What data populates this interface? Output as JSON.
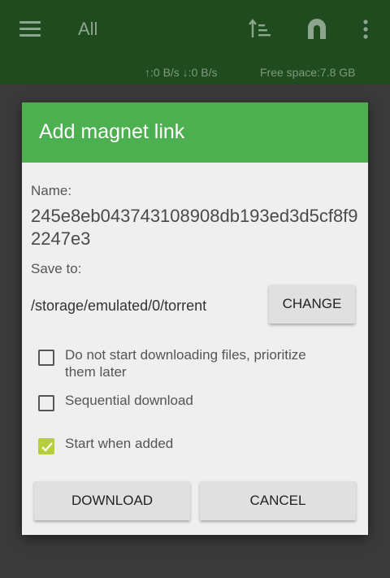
{
  "appbar": {
    "title": "All",
    "icons": [
      "menu-icon",
      "sort-icon",
      "magnet-icon",
      "more-vert-icon"
    ]
  },
  "status": {
    "speed": "↑:0 B/s  ↓:0 B/s",
    "free_space": "Free space:7.8 GB"
  },
  "dialog": {
    "title": "Add magnet link",
    "name_label": "Name:",
    "name_value": "245e8eb043743108908db193ed3d5cf8f92247e3",
    "save_label": "Save to:",
    "save_path": "/storage/emulated/0/torrent",
    "change_label": "CHANGE",
    "options": [
      {
        "label": "Do not start downloading files, prioritize them later",
        "checked": false
      },
      {
        "label": "Sequential download",
        "checked": false
      },
      {
        "label": "Start when added",
        "checked": true
      }
    ],
    "download_label": "DOWNLOAD",
    "cancel_label": "CANCEL"
  },
  "colors": {
    "appbar": "#1f4b1f",
    "dialog_header": "#4caf50",
    "checkbox_checked": "#b5cf3a"
  }
}
